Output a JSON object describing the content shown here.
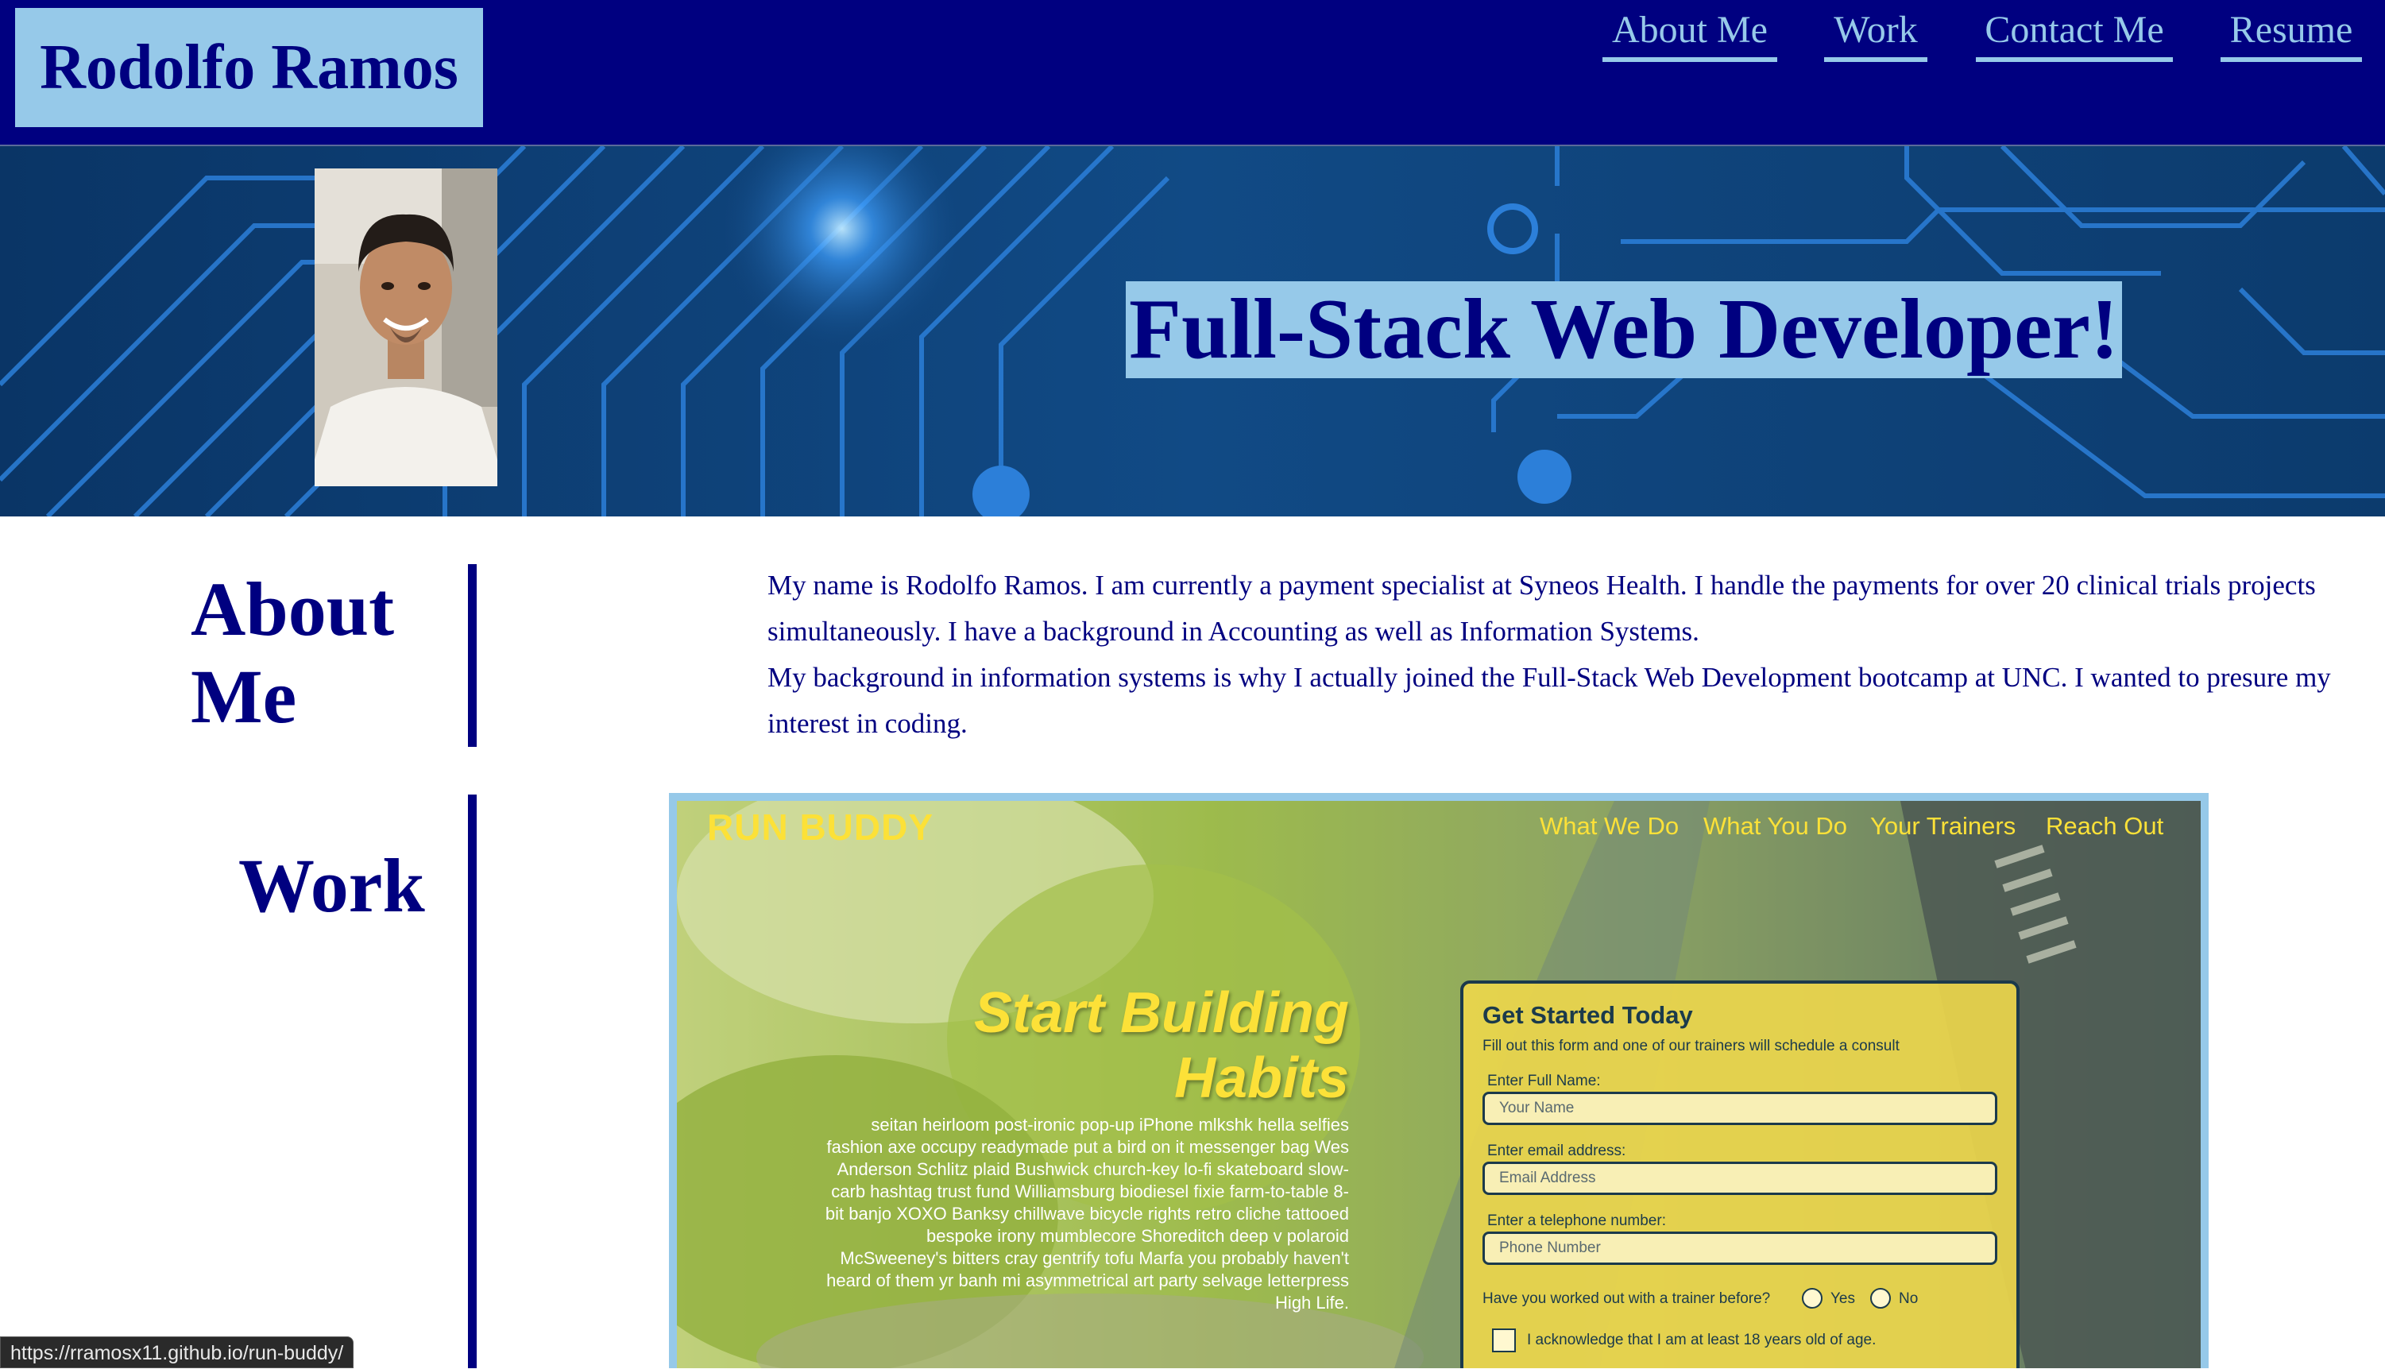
{
  "header": {
    "name": "Rodolfo Ramos",
    "nav": [
      "About Me",
      "Work",
      "Contact Me",
      "Resume"
    ]
  },
  "hero": {
    "tagline": "Full-Stack Web Developer!",
    "portrait": "portrait-photo"
  },
  "about": {
    "heading": "About Me",
    "paragraphs": [
      "My name is Rodolfo Ramos. I am currently a payment specialist at Syneos Health. I handle the payments for over 20 clinical trials projects simultaneously. I have a background in Accounting as well as Information Systems.",
      "My background in information systems is why I actually joined the Full-Stack Web Development bootcamp at UNC. I wanted to presure my interest in coding."
    ]
  },
  "work": {
    "heading": "Work",
    "project": {
      "brand": "RUN BUDDY",
      "nav": [
        "What We Do",
        "What You Do",
        "Your Trainers",
        "Reach Out"
      ],
      "hero_title_line1": "Start Building",
      "hero_title_line2": "Habits",
      "hero_body": "seitan heirloom post-ironic pop-up iPhone mlkshk hella selfies fashion axe occupy readymade put a bird on it messenger bag Wes Anderson Schlitz plaid Bushwick church-key lo-fi skateboard slow-carb hashtag trust fund Williamsburg biodiesel fixie farm-to-table 8-bit banjo XOXO Banksy chillwave bicycle rights retro cliche tattooed bespoke irony mumblecore Shoreditch deep v polaroid McSweeney's bitters cray gentrify tofu Marfa you probably haven't heard of them yr banh mi asymmetrical art party selvage letterpress High Life.",
      "form": {
        "title": "Get Started Today",
        "subtitle": "Fill out this form and one of our trainers will schedule a consult",
        "name_label": "Enter Full Name:",
        "name_placeholder": "Your Name",
        "email_label": "Enter email address:",
        "email_placeholder": "Email Address",
        "phone_label": "Enter a telephone number:",
        "phone_placeholder": "Phone Number",
        "question": "Have you worked out with a trainer before?",
        "yes": "Yes",
        "no": "No",
        "acknowledge": "I acknowledge that I am at least 18 years old of age."
      }
    }
  },
  "status_url": "https://rramosx11.github.io/run-buddy/",
  "colors": {
    "navy": "#000080",
    "light_blue": "#96c9e9",
    "yellow": "#fce138"
  }
}
